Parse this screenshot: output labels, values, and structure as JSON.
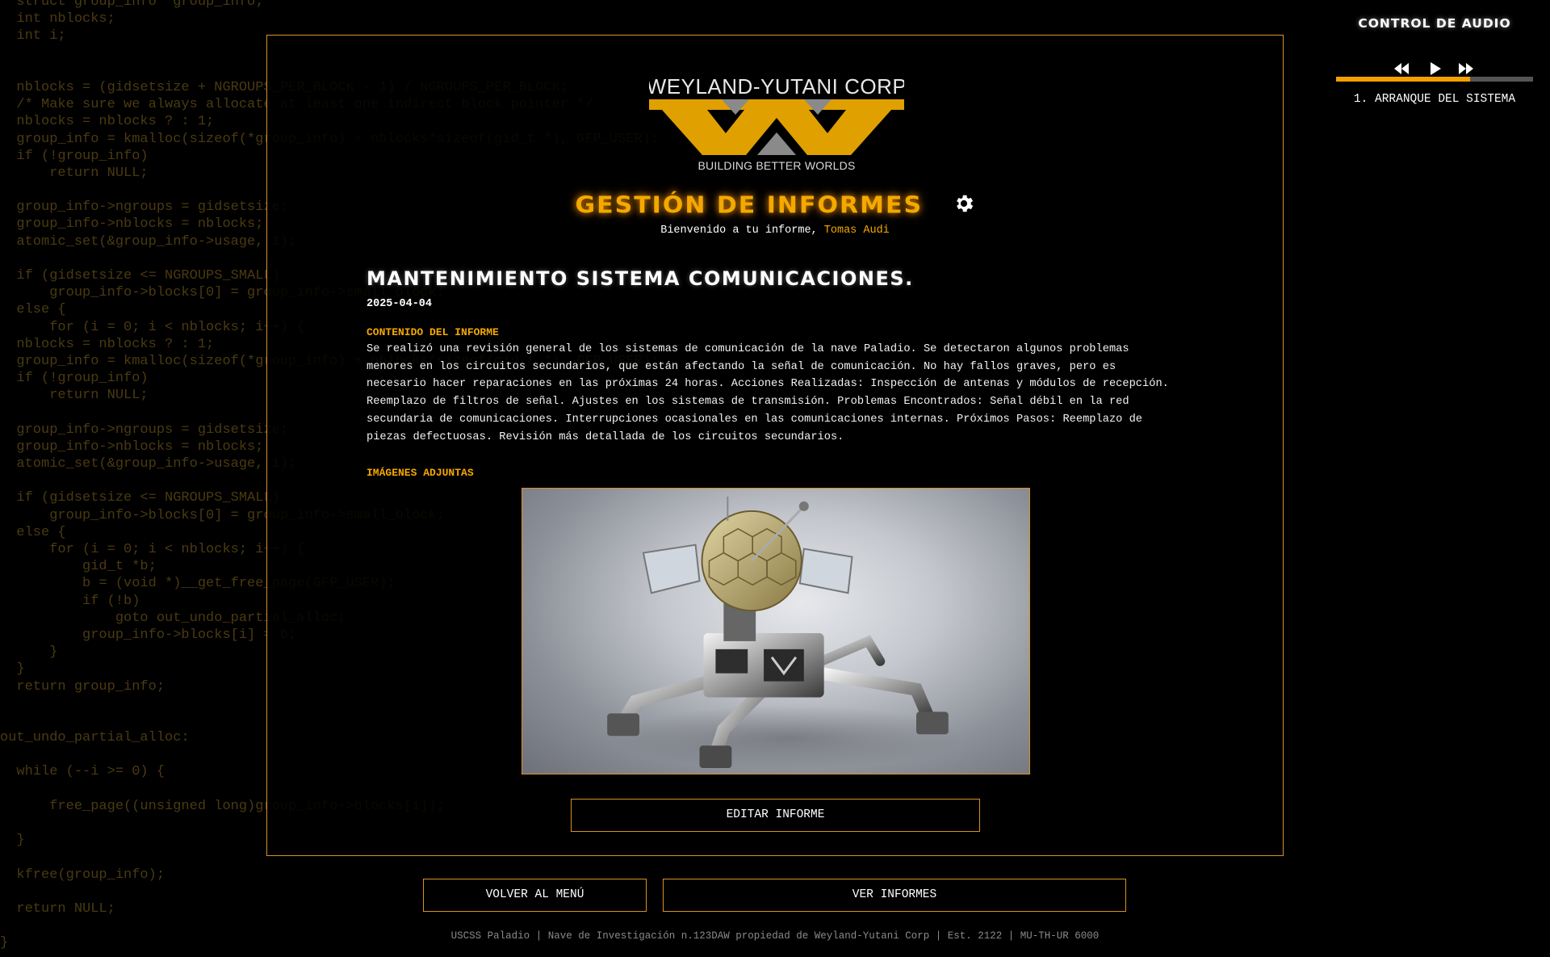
{
  "background_code": [
    "  struct group_info *group_info;",
    "  int nblocks;",
    "  int i;",
    "",
    "",
    "  nblocks = (gidsetsize + NGROUPS_PER_BLOCK - 1) / NGROUPS_PER_BLOCK;",
    "  /* Make sure we always allocate at least one indirect block pointer */",
    "  nblocks = nblocks ? : 1;",
    "  group_info = kmalloc(sizeof(*group_info) + nblocks*sizeof(gid_t *), GFP_USER);",
    "  if (!group_info)",
    "      return NULL;",
    "",
    "  group_info->ngroups = gidsetsize;",
    "  group_info->nblocks = nblocks;",
    "  atomic_set(&group_info->usage, 1);",
    "",
    "  if (gidsetsize <= NGROUPS_SMALL)",
    "      group_info->blocks[0] = group_info->small_block;",
    "  else {",
    "      for (i = 0; i < nblocks; i++) {",
    "  nblocks = nblocks ? : 1;",
    "  group_info = kmalloc(sizeof(*group_info) + nblocks*sizeof(gid_t *), GFP_USER);",
    "  if (!group_info)",
    "      return NULL;",
    "",
    "  group_info->ngroups = gidsetsize;",
    "  group_info->nblocks = nblocks;",
    "  atomic_set(&group_info->usage, 1);",
    "",
    "  if (gidsetsize <= NGROUPS_SMALL)",
    "      group_info->blocks[0] = group_info->small_block;",
    "  else {",
    "      for (i = 0; i < nblocks; i++) {",
    "          gid_t *b;",
    "          b = (void *)__get_free_page(GFP_USER);",
    "          if (!b)",
    "              goto out_undo_partial_alloc;",
    "          group_info->blocks[i] = b;",
    "      }",
    "  }",
    "  return group_info;",
    "",
    "",
    "out_undo_partial_alloc:",
    "",
    "  while (--i >= 0) {",
    "",
    "      free_page((unsigned long)group_info->blocks[i]);",
    "",
    "  }",
    "",
    "  kfree(group_info);",
    "",
    "  return NULL;",
    "",
    "}"
  ],
  "logo": {
    "company": "WEYLAND-YUTANI CORP",
    "tagline": "BUILDING BETTER WORLDS"
  },
  "header": {
    "title": "GESTIÓN DE INFORMES",
    "welcome_prefix": "Bienvenido a tu informe,",
    "user_name": "Tomas Audi"
  },
  "report": {
    "title": "MANTENIMIENTO SISTEMA COMUNICACIONES.",
    "date": "2025-04-04",
    "content_label": "CONTENIDO DEL INFORME",
    "content": "Se realizó una revisión general de los sistemas de comunicación de la nave Paladio. Se detectaron algunos problemas menores en los circuitos secundarios, que están afectando la señal de comunicación. No hay fallos graves, pero es necesario hacer reparaciones en las próximas 24 horas. Acciones Realizadas: Inspección de antenas y módulos de recepción. Reemplazo de filtros de señal. Ajustes en los sistemas de transmisión. Problemas Encontrados: Señal débil en la red secundaria de comunicaciones. Interrupciones ocasionales en las comunicaciones internas. Próximos Pasos: Reemplazo de piezas defectuosas. Revisión más detallada de los circuitos secundarios.",
    "images_label": "IMÁGENES ADJUNTAS"
  },
  "buttons": {
    "edit": "EDITAR INFORME",
    "back": "VOLVER AL MENÚ",
    "view": "VER INFORMES"
  },
  "footer": "USCSS Paladio | Nave de Investigación n.123DAW propiedad de Weyland-Yutani Corp | Est. 2122 | MU-TH-UR 6000",
  "audio": {
    "title": "CONTROL DE AUDIO",
    "track": "1. ARRANQUE DEL SISTEMA",
    "progress": 0.68
  },
  "colors": {
    "accent": "#f5a800",
    "border": "#d8902a",
    "background": "#000000",
    "code": "#4a3a10"
  },
  "icons": [
    "gear-icon",
    "rewind-icon",
    "play-icon",
    "fast-forward-icon"
  ]
}
